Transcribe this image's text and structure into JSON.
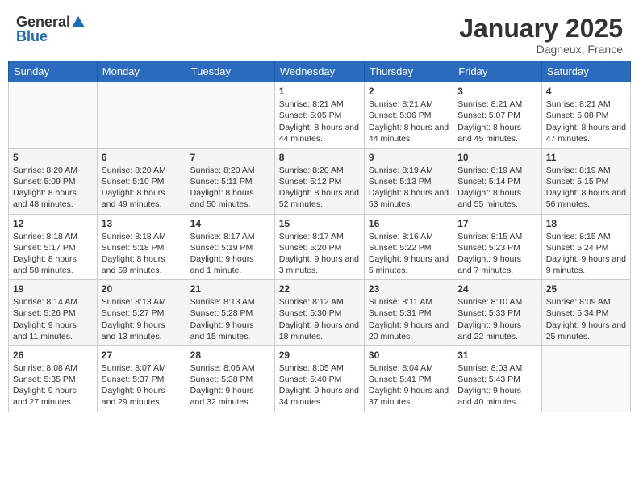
{
  "header": {
    "logo_general": "General",
    "logo_blue": "Blue",
    "title": "January 2025",
    "location": "Dagneux, France"
  },
  "weekdays": [
    "Sunday",
    "Monday",
    "Tuesday",
    "Wednesday",
    "Thursday",
    "Friday",
    "Saturday"
  ],
  "weeks": [
    [
      {
        "day": "",
        "content": ""
      },
      {
        "day": "",
        "content": ""
      },
      {
        "day": "",
        "content": ""
      },
      {
        "day": "1",
        "content": "Sunrise: 8:21 AM\nSunset: 5:05 PM\nDaylight: 8 hours and 44 minutes."
      },
      {
        "day": "2",
        "content": "Sunrise: 8:21 AM\nSunset: 5:06 PM\nDaylight: 8 hours and 44 minutes."
      },
      {
        "day": "3",
        "content": "Sunrise: 8:21 AM\nSunset: 5:07 PM\nDaylight: 8 hours and 45 minutes."
      },
      {
        "day": "4",
        "content": "Sunrise: 8:21 AM\nSunset: 5:08 PM\nDaylight: 8 hours and 47 minutes."
      }
    ],
    [
      {
        "day": "5",
        "content": "Sunrise: 8:20 AM\nSunset: 5:09 PM\nDaylight: 8 hours and 48 minutes."
      },
      {
        "day": "6",
        "content": "Sunrise: 8:20 AM\nSunset: 5:10 PM\nDaylight: 8 hours and 49 minutes."
      },
      {
        "day": "7",
        "content": "Sunrise: 8:20 AM\nSunset: 5:11 PM\nDaylight: 8 hours and 50 minutes."
      },
      {
        "day": "8",
        "content": "Sunrise: 8:20 AM\nSunset: 5:12 PM\nDaylight: 8 hours and 52 minutes."
      },
      {
        "day": "9",
        "content": "Sunrise: 8:19 AM\nSunset: 5:13 PM\nDaylight: 8 hours and 53 minutes."
      },
      {
        "day": "10",
        "content": "Sunrise: 8:19 AM\nSunset: 5:14 PM\nDaylight: 8 hours and 55 minutes."
      },
      {
        "day": "11",
        "content": "Sunrise: 8:19 AM\nSunset: 5:15 PM\nDaylight: 8 hours and 56 minutes."
      }
    ],
    [
      {
        "day": "12",
        "content": "Sunrise: 8:18 AM\nSunset: 5:17 PM\nDaylight: 8 hours and 58 minutes."
      },
      {
        "day": "13",
        "content": "Sunrise: 8:18 AM\nSunset: 5:18 PM\nDaylight: 8 hours and 59 minutes."
      },
      {
        "day": "14",
        "content": "Sunrise: 8:17 AM\nSunset: 5:19 PM\nDaylight: 9 hours and 1 minute."
      },
      {
        "day": "15",
        "content": "Sunrise: 8:17 AM\nSunset: 5:20 PM\nDaylight: 9 hours and 3 minutes."
      },
      {
        "day": "16",
        "content": "Sunrise: 8:16 AM\nSunset: 5:22 PM\nDaylight: 9 hours and 5 minutes."
      },
      {
        "day": "17",
        "content": "Sunrise: 8:15 AM\nSunset: 5:23 PM\nDaylight: 9 hours and 7 minutes."
      },
      {
        "day": "18",
        "content": "Sunrise: 8:15 AM\nSunset: 5:24 PM\nDaylight: 9 hours and 9 minutes."
      }
    ],
    [
      {
        "day": "19",
        "content": "Sunrise: 8:14 AM\nSunset: 5:26 PM\nDaylight: 9 hours and 11 minutes."
      },
      {
        "day": "20",
        "content": "Sunrise: 8:13 AM\nSunset: 5:27 PM\nDaylight: 9 hours and 13 minutes."
      },
      {
        "day": "21",
        "content": "Sunrise: 8:13 AM\nSunset: 5:28 PM\nDaylight: 9 hours and 15 minutes."
      },
      {
        "day": "22",
        "content": "Sunrise: 8:12 AM\nSunset: 5:30 PM\nDaylight: 9 hours and 18 minutes."
      },
      {
        "day": "23",
        "content": "Sunrise: 8:11 AM\nSunset: 5:31 PM\nDaylight: 9 hours and 20 minutes."
      },
      {
        "day": "24",
        "content": "Sunrise: 8:10 AM\nSunset: 5:33 PM\nDaylight: 9 hours and 22 minutes."
      },
      {
        "day": "25",
        "content": "Sunrise: 8:09 AM\nSunset: 5:34 PM\nDaylight: 9 hours and 25 minutes."
      }
    ],
    [
      {
        "day": "26",
        "content": "Sunrise: 8:08 AM\nSunset: 5:35 PM\nDaylight: 9 hours and 27 minutes."
      },
      {
        "day": "27",
        "content": "Sunrise: 8:07 AM\nSunset: 5:37 PM\nDaylight: 9 hours and 29 minutes."
      },
      {
        "day": "28",
        "content": "Sunrise: 8:06 AM\nSunset: 5:38 PM\nDaylight: 9 hours and 32 minutes."
      },
      {
        "day": "29",
        "content": "Sunrise: 8:05 AM\nSunset: 5:40 PM\nDaylight: 9 hours and 34 minutes."
      },
      {
        "day": "30",
        "content": "Sunrise: 8:04 AM\nSunset: 5:41 PM\nDaylight: 9 hours and 37 minutes."
      },
      {
        "day": "31",
        "content": "Sunrise: 8:03 AM\nSunset: 5:43 PM\nDaylight: 9 hours and 40 minutes."
      },
      {
        "day": "",
        "content": ""
      }
    ]
  ]
}
